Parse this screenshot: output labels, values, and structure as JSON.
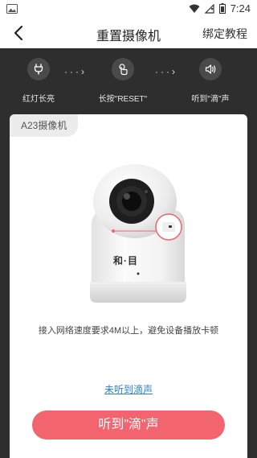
{
  "status_bar": {
    "time": "7:24"
  },
  "nav": {
    "title": "重置摄像机",
    "tutorial": "绑定教程"
  },
  "steps": [
    {
      "label": "红灯长亮"
    },
    {
      "label": "长按\"RESET\""
    },
    {
      "label": "听到\"滴\"声"
    }
  ],
  "arrow_text": "···›",
  "card": {
    "model": "A23摄像机",
    "brand_logo": "和·目",
    "description": "接入网络速度要求4M以上，避免设备播放卡顿",
    "not_heard_link": "未听到滴声",
    "heard_button": "听到\"滴\"声"
  },
  "colors": {
    "accent": "#f2646e",
    "link": "#2a7fd6",
    "dark_bg": "#2e2e2e"
  }
}
